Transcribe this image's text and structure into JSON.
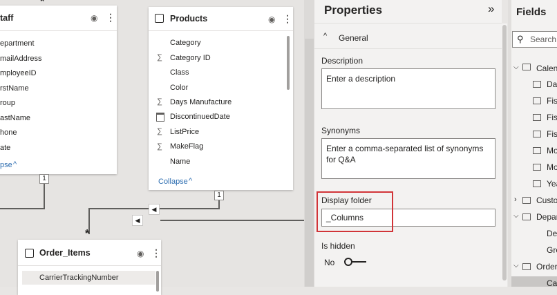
{
  "canvas": {
    "staff_card": {
      "title": "taff",
      "fields": [
        "epartment",
        "mailAddress",
        "mployeeID",
        "rstName",
        "roup",
        "astName",
        "hone",
        "ate"
      ],
      "collapse": "pse"
    },
    "products_card": {
      "title": "Products",
      "fields": [
        {
          "label": "Category",
          "icon": ""
        },
        {
          "label": "Category ID",
          "icon": "∑"
        },
        {
          "label": "Class",
          "icon": ""
        },
        {
          "label": "Color",
          "icon": ""
        },
        {
          "label": "Days Manufacture",
          "icon": "∑"
        },
        {
          "label": "DiscontinuedDate",
          "icon": "calendar"
        },
        {
          "label": "ListPrice",
          "icon": "∑"
        },
        {
          "label": "MakeFlag",
          "icon": "∑"
        },
        {
          "label": "Name",
          "icon": ""
        }
      ],
      "collapse": "Collapse"
    },
    "order_items_card": {
      "title": "Order_Items",
      "first_field": "CarrierTrackingNumber"
    },
    "badge_one": "1",
    "badge_one_b": "1",
    "star": "*"
  },
  "properties": {
    "title": "Properties",
    "section": "General",
    "description_label": "Description",
    "description_placeholder": "Enter a description",
    "synonyms_label": "Synonyms",
    "synonyms_placeholder": "Enter a comma-separated list of synonyms for Q&A",
    "display_folder_label": "Display folder",
    "display_folder_value": "_Columns",
    "is_hidden_label": "Is hidden",
    "is_hidden_value": "No"
  },
  "fields": {
    "title": "Fields",
    "search_placeholder": "Search",
    "items": [
      "Calen",
      "Da",
      "Fis",
      "Fis",
      "Fis",
      "Mo",
      "Mo",
      "Yea",
      "Custo",
      "Depar",
      "De",
      "Gro",
      "Order",
      "Ca"
    ]
  },
  "colors": {
    "highlight": "#d13438",
    "selected_row": "#c8c6c4"
  }
}
